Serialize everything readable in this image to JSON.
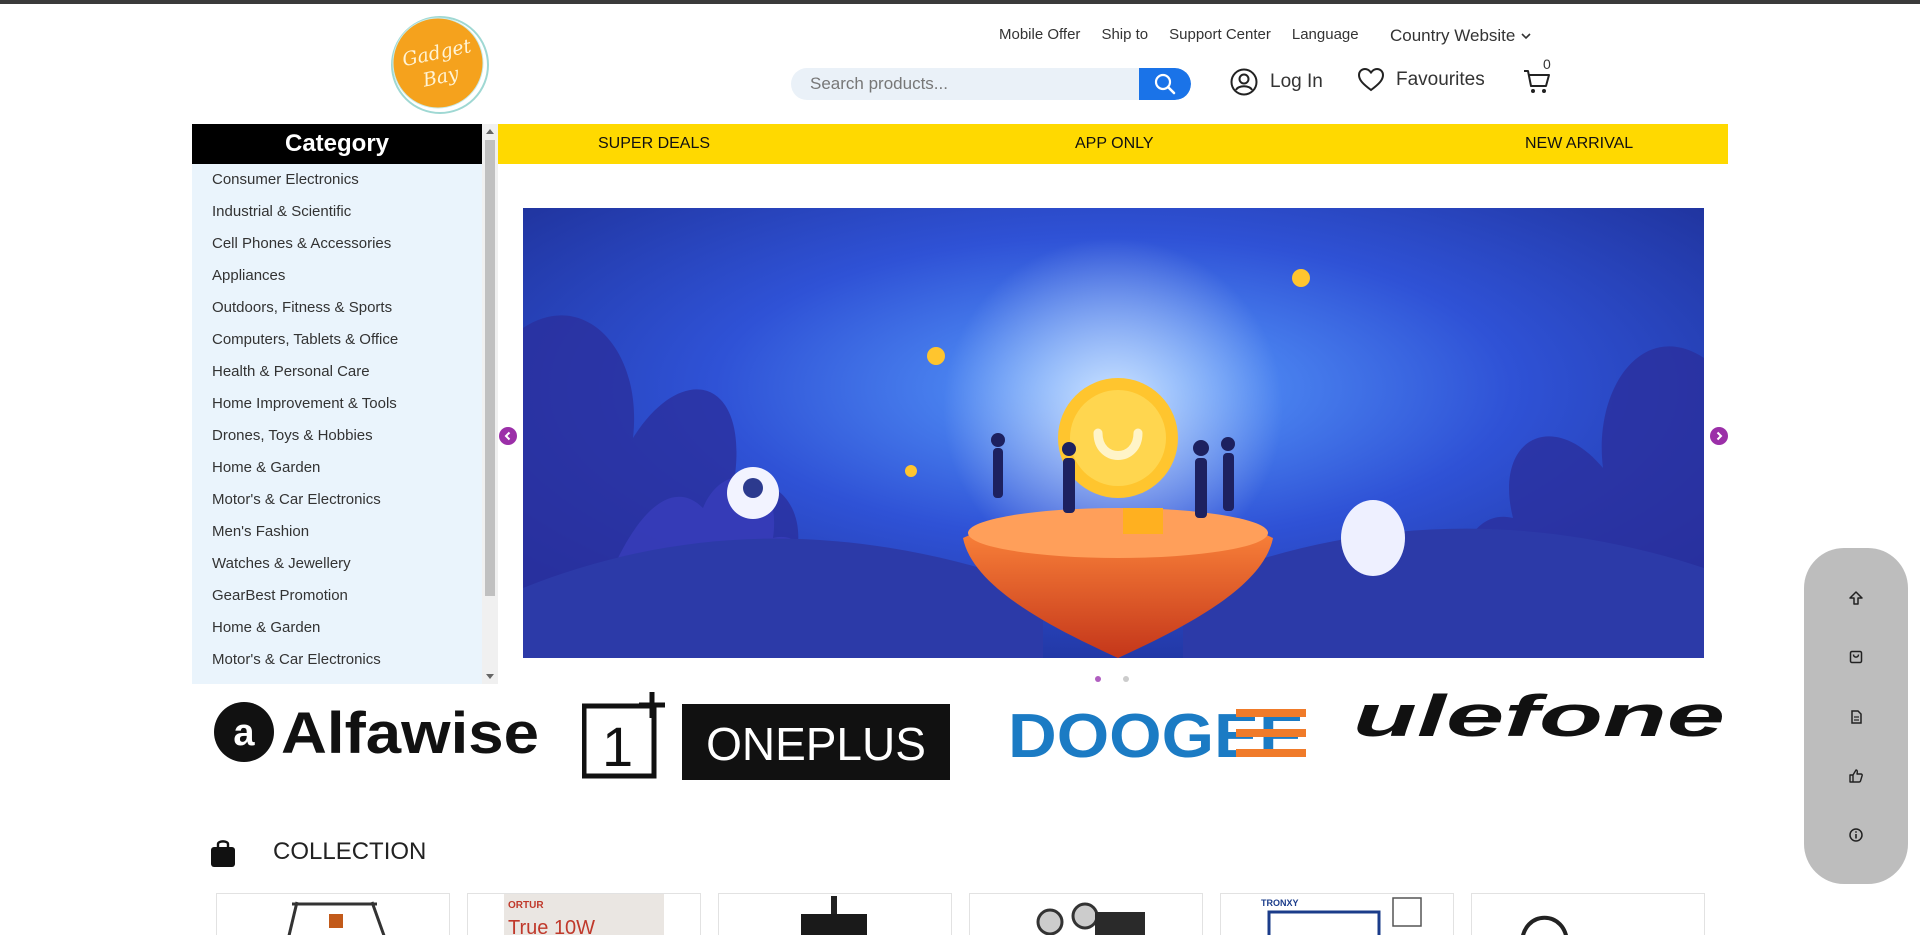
{
  "header": {
    "logo_text": "Gadget Bay",
    "top_links": [
      "Mobile Offer",
      "Ship to",
      "Support Center",
      "Language"
    ],
    "country_label": "Country Website",
    "search_placeholder": "Search products...",
    "login_label": "Log In",
    "favourites_label": "Favourites",
    "cart_count": "0"
  },
  "sidebar": {
    "title": "Category",
    "items": [
      "Consumer Electronics",
      "Industrial & Scientific",
      "Cell Phones & Accessories",
      "Appliances",
      "Outdoors, Fitness & Sports",
      "Computers, Tablets & Office",
      "Health & Personal Care",
      "Home Improvement & Tools",
      "Drones, Toys & Hobbies",
      "Home & Garden",
      "Motor's & Car Electronics",
      "Men's Fashion",
      "Watches & Jewellery",
      "GearBest Promotion",
      "Home & Garden",
      "Motor's & Car Electronics"
    ]
  },
  "dealbar": {
    "items": [
      "SUPER DEALS",
      "APP ONLY",
      "NEW ARRIVAL"
    ]
  },
  "banner": {
    "slides_total": 2,
    "active_slide": 1,
    "accent": "#9b2fa8"
  },
  "brands": [
    "Alfawise",
    "ONEPLUS",
    "DOOGEE",
    "ulefone"
  ],
  "collection": {
    "title": "COLLECTION",
    "card_texts": [
      "ORTUR",
      "True 10W",
      "TRONXY"
    ]
  },
  "colors": {
    "dealbar": "#ffd900",
    "search_button": "#1a73e8",
    "sidebar_bg": "#eaf4fc",
    "doogee_blue": "#1b7bc4",
    "doogee_orange": "#f07b2a"
  },
  "floating_toolbar": {
    "icons": [
      "scroll-top-icon",
      "cart-icon",
      "document-icon",
      "thumbs-up-icon",
      "info-icon"
    ]
  }
}
